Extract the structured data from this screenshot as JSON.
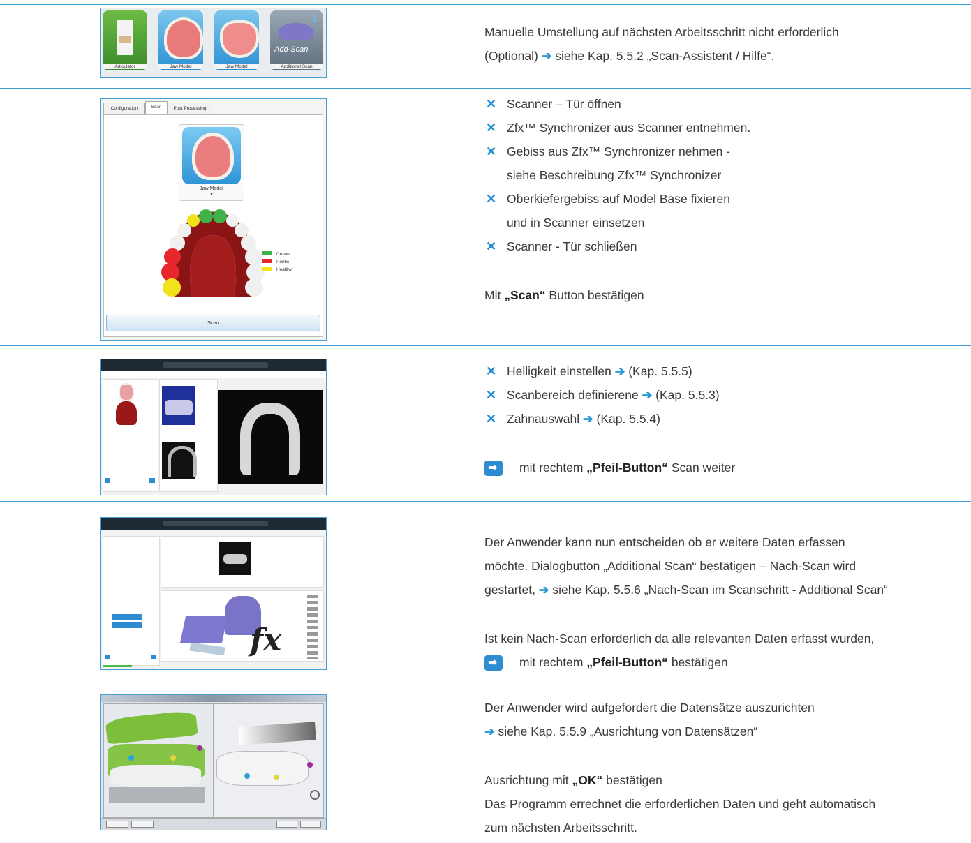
{
  "rows": [
    {
      "thumb": {
        "tiles": [
          "Articulator",
          "Jaw Model",
          "Jaw Model",
          "Additional Scan"
        ],
        "add_scan_overlay": "Add-Scan"
      },
      "text_line1": "Manuelle Umstellung auf nächsten Arbeitsschritt nicht erforderlich",
      "text_line2_pre": "(Optional)",
      "text_line2_post": "siehe Kap. 5.5.2 „Scan-Assistent / Hilfe“."
    },
    {
      "thumb": {
        "tabs": [
          "Configuration",
          "Scan",
          "Post Processing"
        ],
        "model_label": "Jaw Model",
        "legend": [
          {
            "label": "Crown",
            "color": "#3ab54a"
          },
          {
            "label": "Pontic",
            "color": "#e8262e"
          },
          {
            "label": "Healthy",
            "color": "#f2e21b"
          }
        ],
        "scan_button": "Scan"
      },
      "bullets": [
        [
          "Scanner – Tür öffnen"
        ],
        [
          "Zfx™ Synchronizer aus Scanner entnehmen."
        ],
        [
          "Gebiss aus Zfx™ Synchronizer nehmen -",
          "siehe Beschreibung Zfx™ Synchronizer"
        ],
        [
          "Oberkiefergebiss auf Model Base fixieren",
          "und in Scanner einsetzen"
        ],
        [
          "Scanner - Tür schließen"
        ]
      ],
      "confirm_pre": "Mit",
      "confirm_bold": "„Scan“",
      "confirm_post": "Button bestätigen"
    },
    {
      "bullets": [
        {
          "text": "Helligkeit einstellen",
          "ref": "(Kap. 5.5.5)"
        },
        {
          "text": "Scanbereich definierene",
          "ref": "(Kap. 5.5.3)"
        },
        {
          "text": "Zahnauswahl",
          "ref": "(Kap. 5.5.4)"
        }
      ],
      "arrow_pre": "mit rechtem",
      "arrow_bold": "„Pfeil-Button“",
      "arrow_post": "Scan weiter"
    },
    {
      "para_line1": "Der Anwender kann nun entscheiden ob er weitere Daten erfassen",
      "para_line2": "möchte. Dialogbutton „Additional Scan“ bestätigen – Nach-Scan wird",
      "para_line3_pre": "gestartet,",
      "para_line3_post": "siehe Kap. 5.5.6 „Nach-Scan im Scanschritt - Additional Scan“",
      "para2_line1": "Ist kein Nach-Scan erforderlich da alle relevanten Daten erfasst wurden,",
      "arrow_pre": "mit rechtem",
      "arrow_bold": "„Pfeil-Button“",
      "arrow_post": "bestätigen"
    },
    {
      "line1": "Der Anwender wird aufgefordert die Datensätze auszurichten",
      "line2": "siehe Kap. 5.5.9 „Ausrichtung von Datensätzen“",
      "line3_pre": "Ausrichtung mit",
      "line3_bold": "„OK“",
      "line3_post": "bestätigen",
      "line4": "Das Programm errechnet die erforderlichen Daten und geht automatisch",
      "line5": "zum nächsten Arbeitsschritt."
    }
  ]
}
